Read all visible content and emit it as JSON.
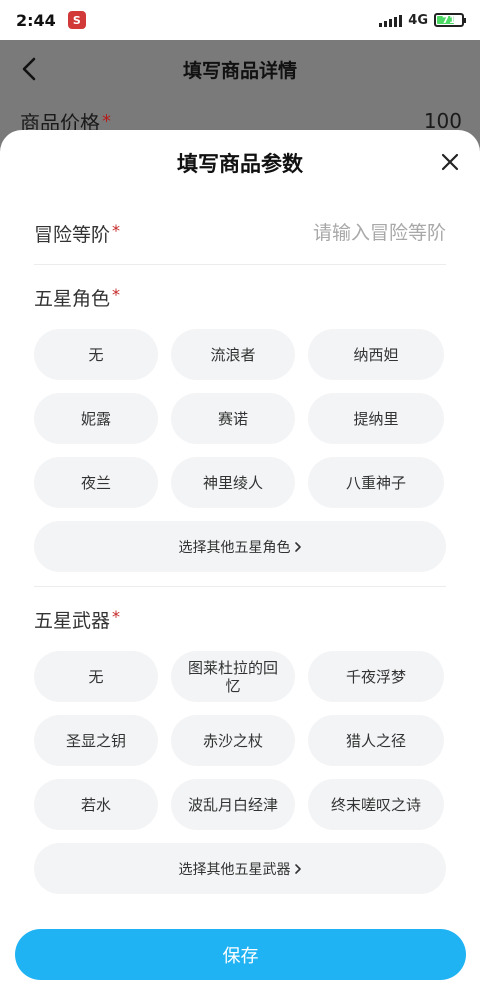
{
  "status_bar": {
    "time": "2:44",
    "network": "4G",
    "battery": "71"
  },
  "background_page": {
    "title": "填写商品详情",
    "price_label": "商品价格",
    "required_mark": "*",
    "price_value": "100"
  },
  "sheet": {
    "title": "填写商品参数",
    "adventure_rank": {
      "label": "冒险等阶",
      "required_mark": "*",
      "placeholder": "请输入冒险等阶",
      "value": ""
    },
    "characters": {
      "label": "五星角色",
      "required_mark": "*",
      "options": [
        "无",
        "流浪者",
        "纳西妲",
        "妮露",
        "赛诺",
        "提纳里",
        "夜兰",
        "神里绫人",
        "八重神子"
      ],
      "more_label": "选择其他五星角色"
    },
    "weapons": {
      "label": "五星武器",
      "required_mark": "*",
      "options": [
        "无",
        "图莱杜拉的回忆",
        "千夜浮梦",
        "圣显之钥",
        "赤沙之杖",
        "猎人之径",
        "若水",
        "波乱月白经津",
        "终末嗟叹之诗"
      ],
      "more_label": "选择其他五星武器"
    },
    "save_label": "保存"
  },
  "icons": {
    "back": "back-arrow-icon",
    "close": "close-icon",
    "chevron": "chevron-right-icon",
    "app": "app-badge-icon",
    "signal": "signal-icon",
    "battery": "battery-icon"
  },
  "colors": {
    "accent": "#20b3f4",
    "required": "#c62828",
    "chip_bg": "#f3f4f6"
  }
}
